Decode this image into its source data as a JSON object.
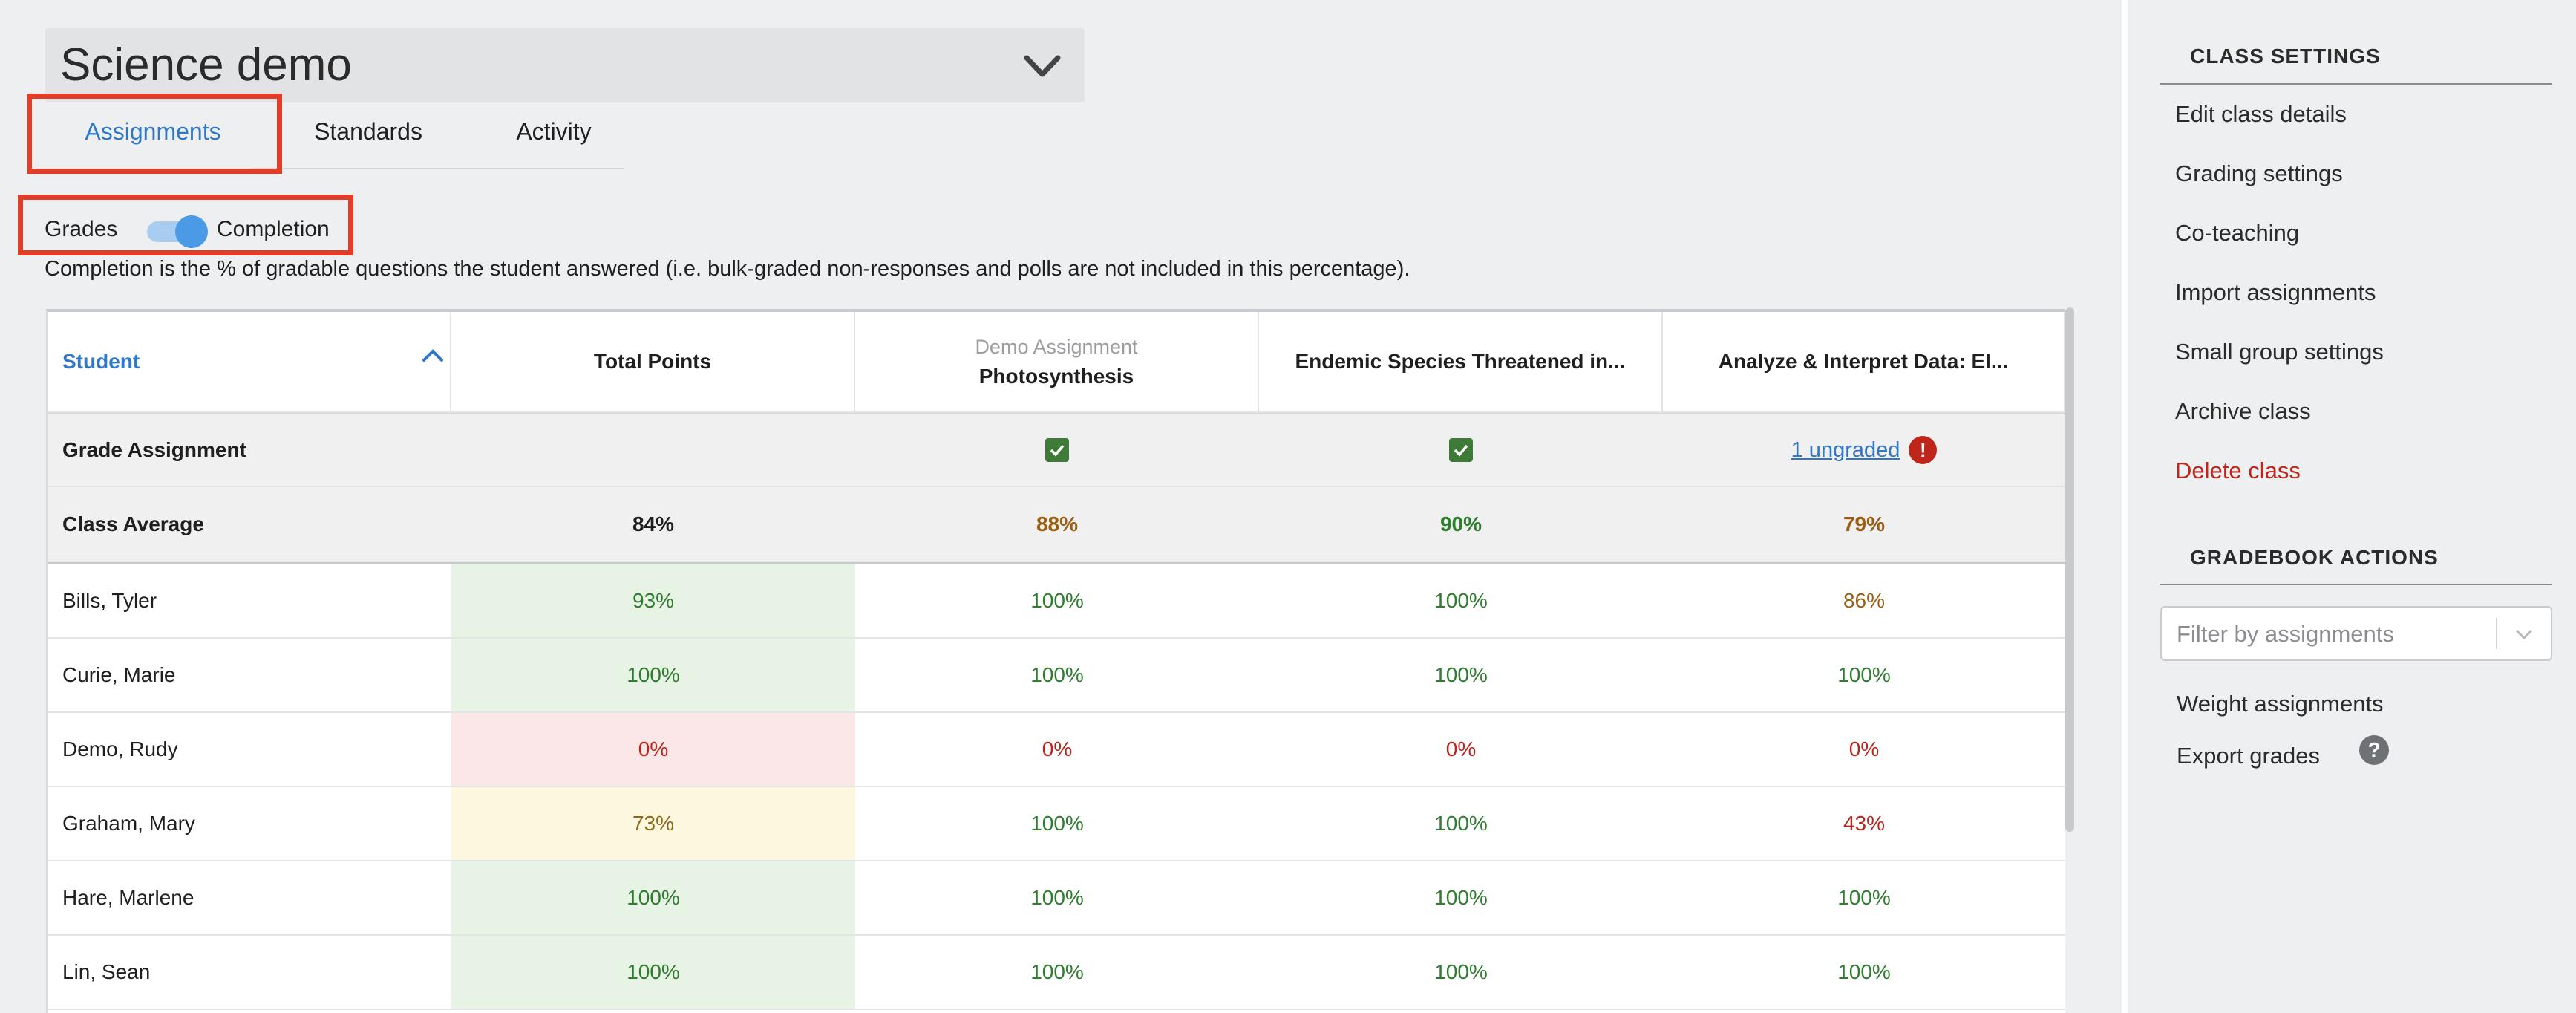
{
  "class_select": {
    "name": "Science demo"
  },
  "tabs": [
    {
      "label": "Assignments",
      "active": true
    },
    {
      "label": "Standards",
      "active": false
    },
    {
      "label": "Activity",
      "active": false
    }
  ],
  "toggle": {
    "left_label": "Grades",
    "right_label": "Completion",
    "state": "Completion"
  },
  "note": "Completion is the % of gradable questions the student answered (i.e. bulk-graded non-responses and polls are not included in this percentage).",
  "table": {
    "headers": {
      "student": "Student",
      "total": "Total Points",
      "col1_sub": "Demo Assignment",
      "col1": "Photosynthesis",
      "col2": "Endemic Species Threatened in...",
      "col3": "Analyze & Interpret Data: El..."
    },
    "grade_row": {
      "label": "Grade Assignment",
      "ungraded": "1 ungraded",
      "alert": "!"
    },
    "avg_row": {
      "label": "Class Average",
      "total": "84%",
      "col1": "88%",
      "col2": "90%",
      "col3": "79%"
    },
    "rows": [
      {
        "name": "Bills, Tyler",
        "total": "93%",
        "col1": "100%",
        "col2": "100%",
        "col3": "86%"
      },
      {
        "name": "Curie, Marie",
        "total": "100%",
        "col1": "100%",
        "col2": "100%",
        "col3": "100%"
      },
      {
        "name": "Demo, Rudy",
        "total": "0%",
        "col1": "0%",
        "col2": "0%",
        "col3": "0%"
      },
      {
        "name": "Graham, Mary",
        "total": "73%",
        "col1": "100%",
        "col2": "100%",
        "col3": "43%"
      },
      {
        "name": "Hare, Marlene",
        "total": "100%",
        "col1": "100%",
        "col2": "100%",
        "col3": "100%"
      },
      {
        "name": "Lin, Sean",
        "total": "100%",
        "col1": "100%",
        "col2": "100%",
        "col3": "100%"
      }
    ]
  },
  "sidebar": {
    "class_settings_title": "CLASS SETTINGS",
    "links": [
      "Edit class details",
      "Grading settings",
      "Co-teaching",
      "Import assignments",
      "Small group settings",
      "Archive class"
    ],
    "delete": "Delete class",
    "gradebook_title": "GRADEBOOK ACTIONS",
    "filter_placeholder": "Filter by assignments",
    "weight": "Weight assignments",
    "export": "Export grades",
    "help": "?"
  },
  "colors": {
    "accent": "#2f78c8",
    "highlight": "#e23d28",
    "green": "#2f7d2f",
    "red": "#b8261b",
    "orange": "#9a5e12"
  }
}
